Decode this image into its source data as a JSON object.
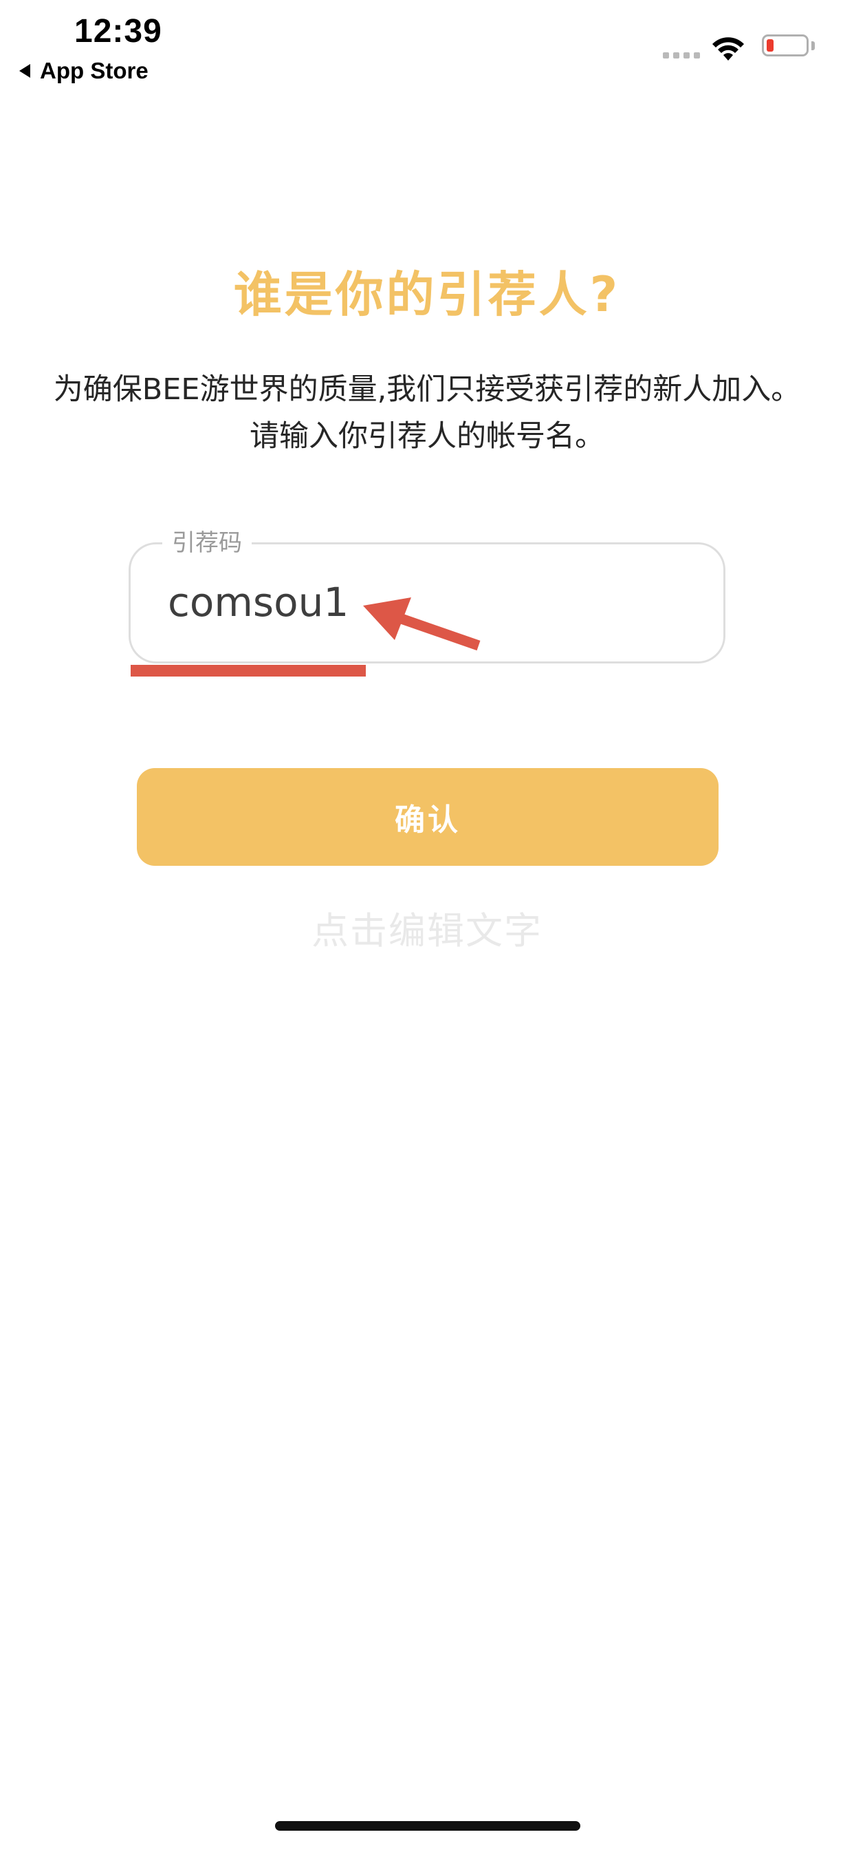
{
  "status_bar": {
    "time": "12:39",
    "back_label": "App Store",
    "icons": [
      "signal-icon",
      "wifi-icon",
      "battery-icon"
    ],
    "battery_color": "#ec3b2d"
  },
  "page": {
    "title": "谁是你的引荐人?",
    "subtitle": "为确保BEE游世界的质量,我们只接受获引荐的新人加入。 请输入你引荐人的帐号名。"
  },
  "referral_field": {
    "legend": "引荐码",
    "value": "comsou1"
  },
  "annotations": {
    "color": "#dd5747",
    "items": [
      "underline",
      "arrow"
    ]
  },
  "actions": {
    "confirm_label": "确认",
    "edit_hint": "点击编辑文字"
  },
  "colors": {
    "accent": "#f3c265",
    "field_border": "#dedede",
    "hint_text": "#e9e9e9"
  }
}
